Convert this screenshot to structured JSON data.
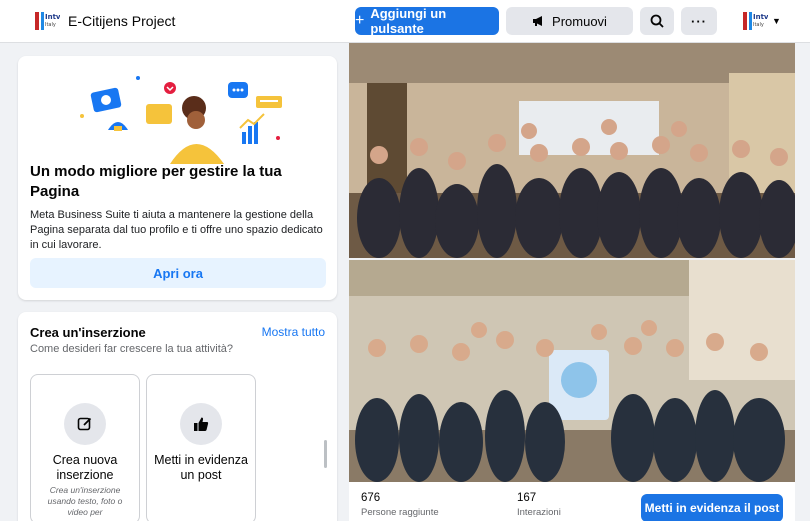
{
  "header": {
    "page_name": "E-Citijens Project",
    "add_button_label": "Aggiungi un pulsante",
    "promote_label": "Promuovi",
    "more_label": "···",
    "colors": {
      "primary": "#1b74e4",
      "secondary_bg": "#e4e6eb"
    }
  },
  "mbs_card": {
    "title": "Un modo migliore per gestire la tua Pagina",
    "description": "Meta Business Suite ti aiuta a mantenere la gestione della Pagina separata dal tuo profilo e ti offre uno spazio dedicato in cui lavorare.",
    "button_label": "Apri ora"
  },
  "ad_card": {
    "title": "Crea un'inserzione",
    "see_all": "Mostra tutto",
    "subtitle": "Come desideri far crescere la tua attività?",
    "options": [
      {
        "icon": "edit-icon",
        "title": "Crea nuova inserzione",
        "description": "Crea un'inserzione usando testo, foto o video per"
      },
      {
        "icon": "thumbs-up-icon",
        "title": "Metti in evidenza un post",
        "description": ""
      }
    ]
  },
  "post": {
    "reach": "676",
    "reach_label": "Persone raggiunte",
    "interactions": "167",
    "interactions_label": "Interazioni",
    "boost_label": "Metti in evidenza il post"
  }
}
